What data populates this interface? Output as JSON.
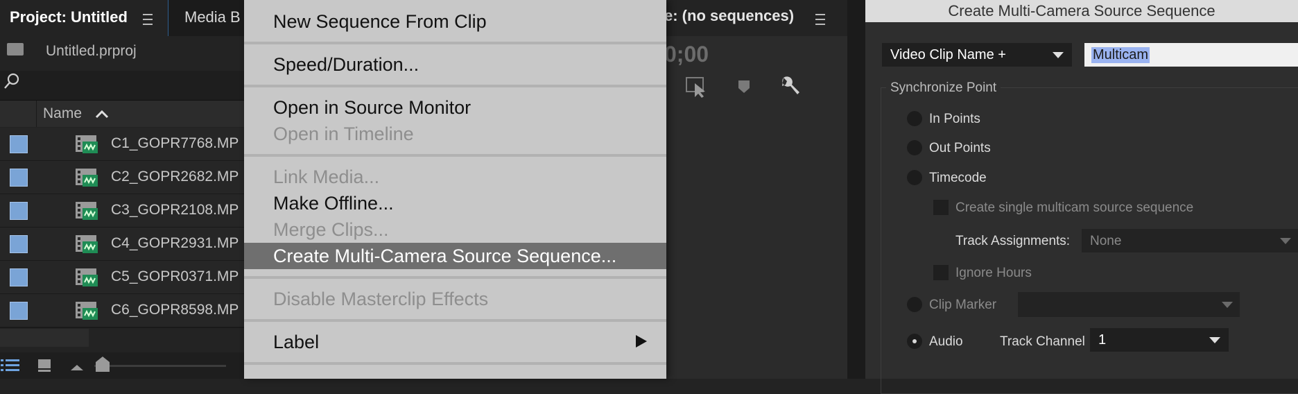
{
  "project_panel": {
    "tab_project": "Project: Untitled",
    "tab_media": "Media B",
    "file_name": "Untitled.prproj",
    "column_name": "Name",
    "clips": [
      "C1_GOPR7768.MP",
      "C2_GOPR2682.MP",
      "C3_GOPR2108.MP",
      "C4_GOPR2931.MP",
      "C5_GOPR0371.MP",
      "C6_GOPR8598.MP"
    ]
  },
  "program_monitor": {
    "tab_title": "e: (no sequences)",
    "timecode": "0;00"
  },
  "context_menu": {
    "new_sequence": "New Sequence From Clip",
    "speed_duration": "Speed/Duration...",
    "open_source": "Open in Source Monitor",
    "open_timeline": "Open in Timeline",
    "link_media": "Link Media...",
    "make_offline": "Make Offline...",
    "merge_clips": "Merge Clips...",
    "create_multicam": "Create Multi-Camera Source Sequence...",
    "disable_effects": "Disable Masterclip Effects",
    "label": "Label"
  },
  "dialog": {
    "title": "Create Multi-Camera Source Sequence",
    "name_option": "Video Clip Name +",
    "name_value": "Multicam",
    "sync_group": "Synchronize Point",
    "in_points": "In Points",
    "out_points": "Out Points",
    "timecode": "Timecode",
    "single_sequence": "Create single multicam source sequence",
    "track_assignments": "Track Assignments:",
    "track_assignments_value": "None",
    "ignore_hours": "Ignore Hours",
    "clip_marker": "Clip Marker",
    "audio": "Audio",
    "track_channel": "Track Channel",
    "track_channel_value": "1"
  }
}
